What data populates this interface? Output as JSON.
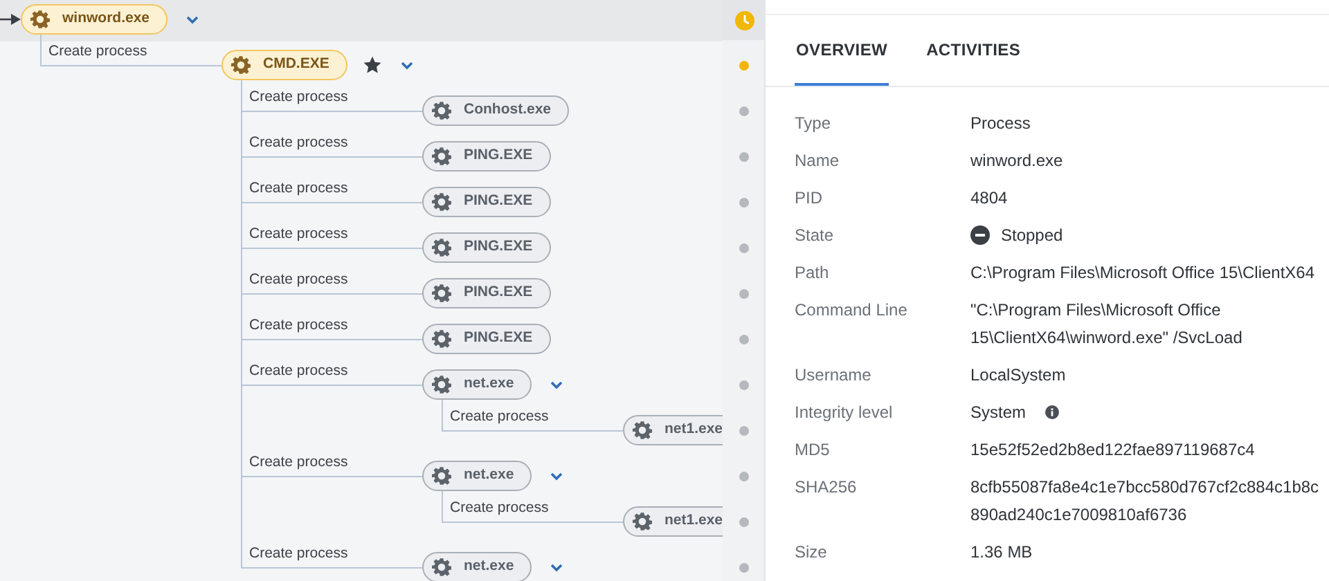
{
  "process_tree": {
    "label": "winword.exe",
    "highlighted": true,
    "starred": false,
    "expandable": true,
    "children": [
      {
        "edge_label": "Create process",
        "label": "CMD.EXE",
        "highlighted": true,
        "starred": true,
        "expandable": true,
        "children": [
          {
            "edge_label": "Create process",
            "label": "Conhost.exe",
            "highlighted": false,
            "starred": false,
            "expandable": false
          },
          {
            "edge_label": "Create process",
            "label": "PING.EXE",
            "highlighted": false,
            "starred": false,
            "expandable": false
          },
          {
            "edge_label": "Create process",
            "label": "PING.EXE",
            "highlighted": false,
            "starred": false,
            "expandable": false
          },
          {
            "edge_label": "Create process",
            "label": "PING.EXE",
            "highlighted": false,
            "starred": false,
            "expandable": false
          },
          {
            "edge_label": "Create process",
            "label": "PING.EXE",
            "highlighted": false,
            "starred": false,
            "expandable": false
          },
          {
            "edge_label": "Create process",
            "label": "PING.EXE",
            "highlighted": false,
            "starred": false,
            "expandable": false
          },
          {
            "edge_label": "Create process",
            "label": "net.exe",
            "highlighted": false,
            "starred": false,
            "expandable": true,
            "children": [
              {
                "edge_label": "Create process",
                "label": "net1.exe",
                "highlighted": false,
                "starred": false,
                "expandable": false
              }
            ]
          },
          {
            "edge_label": "Create process",
            "label": "net.exe",
            "highlighted": false,
            "starred": false,
            "expandable": true,
            "children": [
              {
                "edge_label": "Create process",
                "label": "net1.exe",
                "highlighted": false,
                "starred": false,
                "expandable": false
              }
            ]
          },
          {
            "edge_label": "Create process",
            "label": "net.exe",
            "highlighted": false,
            "starred": false,
            "expandable": true
          }
        ]
      }
    ]
  },
  "timeline": [
    {
      "color": "#f2b705"
    },
    {
      "color": "#b5b8bc"
    },
    {
      "color": "#b5b8bc"
    },
    {
      "color": "#b5b8bc"
    },
    {
      "color": "#b5b8bc"
    },
    {
      "color": "#b5b8bc"
    },
    {
      "color": "#b5b8bc"
    },
    {
      "color": "#b5b8bc"
    },
    {
      "color": "#b5b8bc"
    },
    {
      "color": "#b5b8bc"
    },
    {
      "color": "#b5b8bc"
    },
    {
      "color": "#b5b8bc"
    }
  ],
  "tabs": [
    {
      "label": "OVERVIEW",
      "selected": true
    },
    {
      "label": "ACTIVITIES",
      "selected": false
    }
  ],
  "details": [
    {
      "label": "Type",
      "lines": [
        "Process"
      ]
    },
    {
      "label": "Name",
      "lines": [
        "winword.exe"
      ]
    },
    {
      "label": "PID",
      "lines": [
        "4804"
      ]
    },
    {
      "label": "State",
      "lines": [
        "Stopped"
      ],
      "stopped": true
    },
    {
      "label": "Path",
      "lines": [
        "C:\\Program Files\\Microsoft Office 15\\ClientX64"
      ]
    },
    {
      "label": "Command Line",
      "lines": [
        "\"C:\\Program Files\\Microsoft Office",
        "15\\ClientX64\\winword.exe\" /SvcLoad"
      ]
    },
    {
      "label": "Username",
      "lines": [
        "LocalSystem"
      ]
    },
    {
      "label": "Integrity level",
      "lines": [
        "System"
      ],
      "info": true
    },
    {
      "label": "MD5",
      "lines": [
        "15e52f52ed2b8ed122fae897119687c4"
      ]
    },
    {
      "label": "SHA256",
      "lines": [
        "8cfb55087fa8e4c1e7bcc580d767cf2c884c1b8c",
        "890ad240c1e7009810af6736"
      ]
    },
    {
      "label": "Size",
      "lines": [
        "1.36 MB"
      ]
    }
  ]
}
